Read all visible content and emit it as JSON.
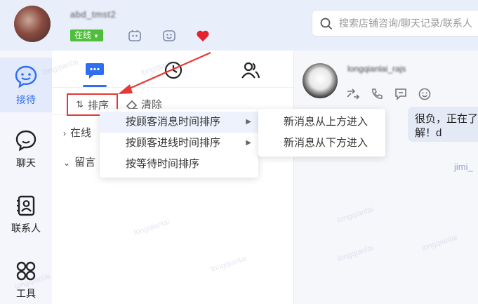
{
  "topbar": {
    "status_label": "在线",
    "search": {
      "placeholder": "搜索店铺咨询/聊天记录/联系人"
    }
  },
  "leftnav": {
    "items": [
      {
        "label": "接待",
        "icon": "smile-chat-icon",
        "active": true
      },
      {
        "label": "聊天",
        "icon": "chat-bubble-icon"
      },
      {
        "label": "联系人",
        "icon": "contact-book-icon"
      },
      {
        "label": "工具",
        "icon": "grid-tools-icon"
      }
    ]
  },
  "middle": {
    "tabs": [
      {
        "icon": "message-icon",
        "active": true
      },
      {
        "icon": "clock-icon"
      },
      {
        "icon": "contacts-icon"
      }
    ],
    "toolbar": {
      "sort_label": "排序",
      "clear_label": "清除"
    },
    "groups": [
      {
        "label": "在线",
        "expanded": false
      },
      {
        "label": "留言",
        "expanded": true
      }
    ]
  },
  "sort_menu": {
    "items": [
      {
        "label": "按顾客消息时间排序",
        "has_submenu": true,
        "hover": true
      },
      {
        "label": "按顾客进线时间排序",
        "has_submenu": true
      },
      {
        "label": "按等待时间排序",
        "has_submenu": false
      }
    ],
    "submenu": [
      {
        "label": "新消息从上方进入"
      },
      {
        "label": "新消息从下方进入"
      }
    ]
  },
  "chat": {
    "bubble_text": "很负，正在了解！d",
    "agent_label": "jimi_"
  },
  "colors": {
    "accent": "#2d6ff0",
    "status_green": "#4fbf3b",
    "highlight_red": "#e53935"
  }
}
